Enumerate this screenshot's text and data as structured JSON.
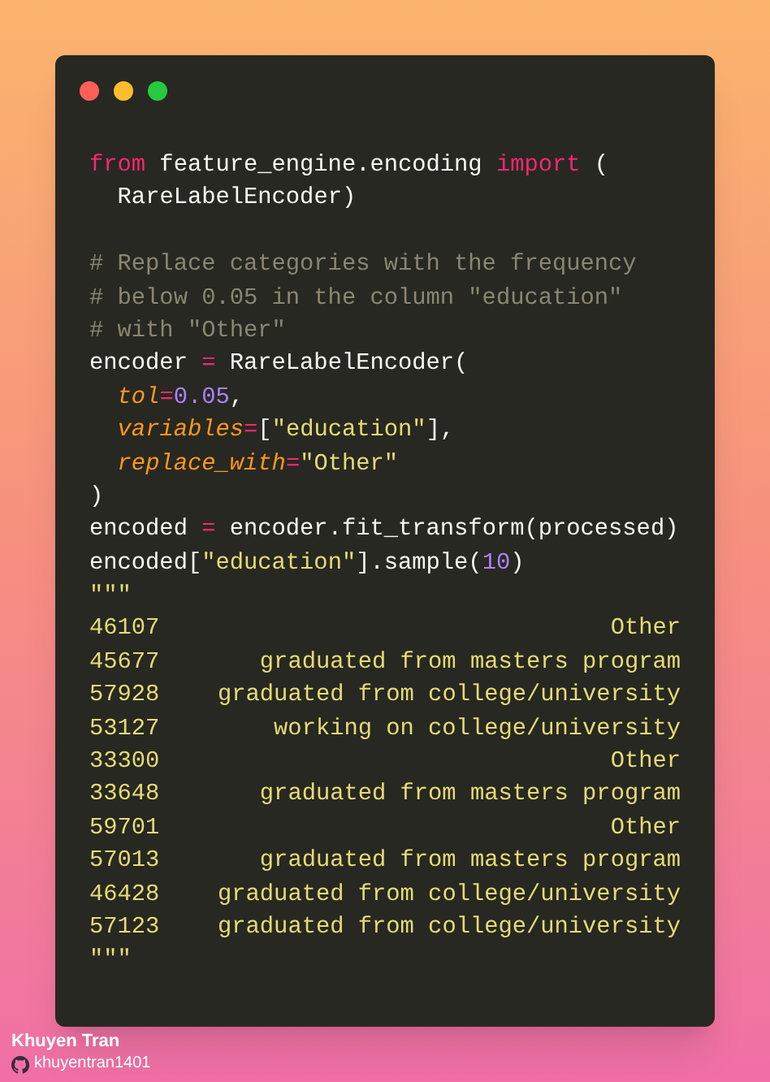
{
  "window": {
    "controls": [
      {
        "kind": "close"
      },
      {
        "kind": "minimize"
      },
      {
        "kind": "zoom"
      }
    ]
  },
  "code_lines": [
    {
      "kind": "code",
      "tokens": [
        {
          "text": "from",
          "kind": "keyword"
        },
        {
          "text": " feature_engine.encoding ",
          "kind": "plain"
        },
        {
          "text": "import",
          "kind": "keyword"
        },
        {
          "text": " (",
          "kind": "plain"
        }
      ]
    },
    {
      "kind": "code",
      "indented": true,
      "tokens": [
        {
          "text": "RareLabelEncoder)",
          "kind": "plain"
        }
      ]
    },
    {
      "kind": "blank"
    },
    {
      "kind": "code",
      "tokens": [
        {
          "text": "# Replace categories with the frequency",
          "kind": "comment"
        }
      ]
    },
    {
      "kind": "code",
      "tokens": [
        {
          "text": "# below 0.05 in the column \"education\"",
          "kind": "comment"
        }
      ]
    },
    {
      "kind": "code",
      "tokens": [
        {
          "text": "# with \"Other\"",
          "kind": "comment"
        }
      ]
    },
    {
      "kind": "code",
      "tokens": [
        {
          "text": "encoder ",
          "kind": "plain"
        },
        {
          "text": "=",
          "kind": "keyword"
        },
        {
          "text": " RareLabelEncoder(",
          "kind": "plain"
        }
      ]
    },
    {
      "kind": "code",
      "indented": true,
      "tokens": [
        {
          "text": "tol",
          "kind": "param"
        },
        {
          "text": "=",
          "kind": "keyword"
        },
        {
          "text": "0.05",
          "kind": "number"
        },
        {
          "text": ",",
          "kind": "plain"
        }
      ]
    },
    {
      "kind": "code",
      "indented": true,
      "tokens": [
        {
          "text": "variables",
          "kind": "param"
        },
        {
          "text": "=",
          "kind": "keyword"
        },
        {
          "text": "[",
          "kind": "plain"
        },
        {
          "text": "\"education\"",
          "kind": "string"
        },
        {
          "text": "],",
          "kind": "plain"
        }
      ]
    },
    {
      "kind": "code",
      "indented": true,
      "tokens": [
        {
          "text": "replace_with",
          "kind": "param"
        },
        {
          "text": "=",
          "kind": "keyword"
        },
        {
          "text": "\"Other\"",
          "kind": "string"
        }
      ]
    },
    {
      "kind": "code",
      "tokens": [
        {
          "text": ")",
          "kind": "plain"
        }
      ]
    },
    {
      "kind": "code",
      "tokens": [
        {
          "text": "encoded ",
          "kind": "plain"
        },
        {
          "text": "=",
          "kind": "keyword"
        },
        {
          "text": " encoder.fit_transform(processed)",
          "kind": "plain"
        }
      ]
    },
    {
      "kind": "code",
      "tokens": [
        {
          "text": "encoded[",
          "kind": "plain"
        },
        {
          "text": "\"education\"",
          "kind": "string"
        },
        {
          "text": "].sample(",
          "kind": "plain"
        },
        {
          "text": "10",
          "kind": "number"
        },
        {
          "text": ")",
          "kind": "plain"
        }
      ]
    }
  ],
  "docstring_open": "\"\"\"",
  "output_rows": [
    {
      "index": "46107",
      "value": "Other"
    },
    {
      "index": "45677",
      "value": "graduated from masters program"
    },
    {
      "index": "57928",
      "value": "graduated from college/university"
    },
    {
      "index": "53127",
      "value": "working on college/university"
    },
    {
      "index": "33300",
      "value": "Other"
    },
    {
      "index": "33648",
      "value": "graduated from masters program"
    },
    {
      "index": "59701",
      "value": "Other"
    },
    {
      "index": "57013",
      "value": "graduated from masters program"
    },
    {
      "index": "46428",
      "value": "graduated from college/university"
    },
    {
      "index": "57123",
      "value": "graduated from college/university"
    }
  ],
  "docstring_close": "\"\"\"",
  "author": {
    "name": "Khuyen Tran",
    "handle": "khuyentran1401"
  }
}
